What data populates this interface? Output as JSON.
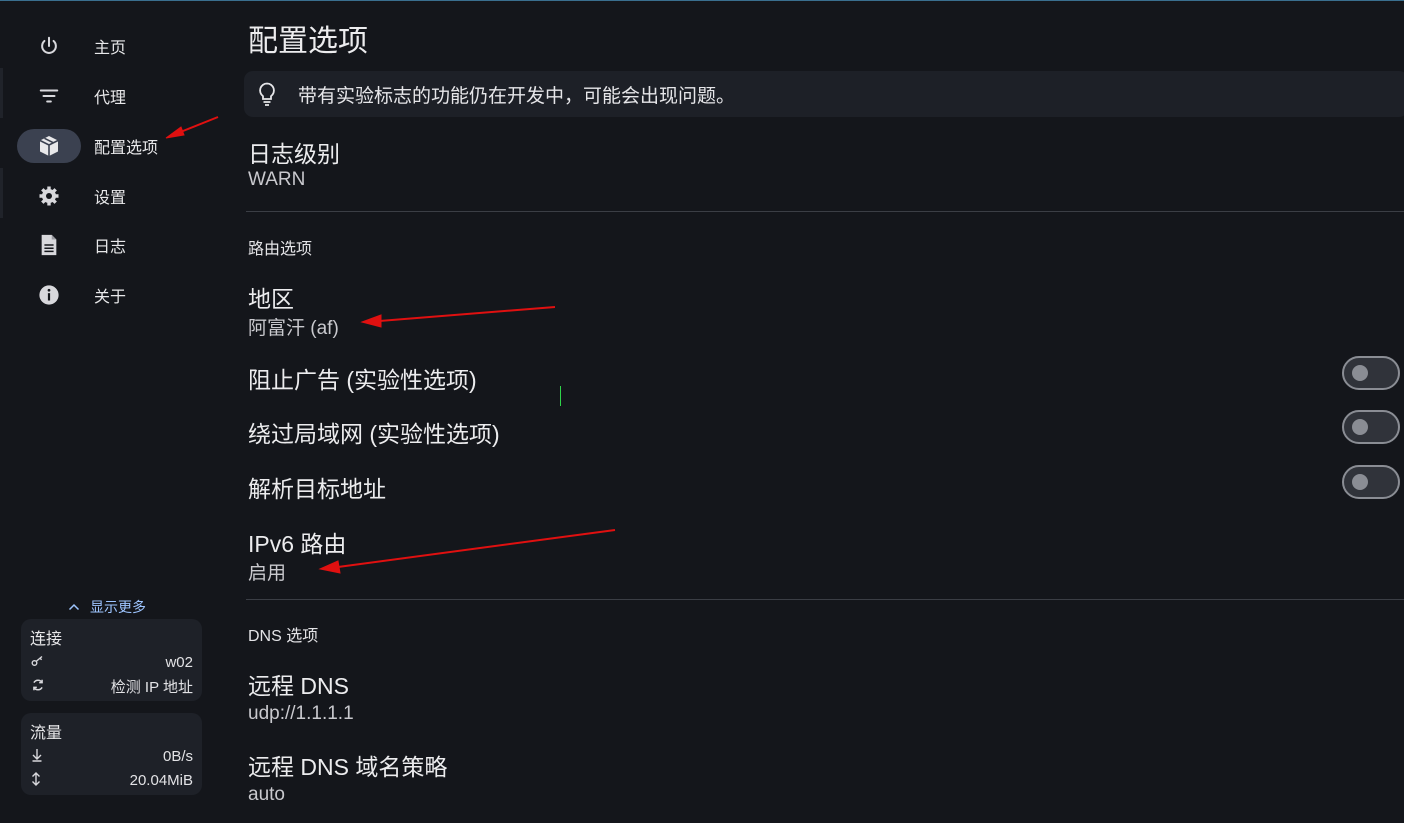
{
  "sidebar": {
    "nav": [
      {
        "label": "主页",
        "icon": "power-icon"
      },
      {
        "label": "代理",
        "icon": "filter-icon"
      },
      {
        "label": "配置选项",
        "icon": "package-icon",
        "active": true
      },
      {
        "label": "设置",
        "icon": "gear-icon"
      },
      {
        "label": "日志",
        "icon": "document-icon"
      },
      {
        "label": "关于",
        "icon": "info-icon"
      }
    ],
    "show_more": "显示更多",
    "connection": {
      "title": "连接",
      "rows": [
        {
          "icon": "key-icon",
          "value": "w02"
        },
        {
          "icon": "refresh-icon",
          "value": "检测 IP 地址"
        }
      ]
    },
    "traffic": {
      "title": "流量",
      "rows": [
        {
          "icon": "arrow-down-icon",
          "value": "0B/s"
        },
        {
          "icon": "arrow-updown-icon",
          "value": "20.04MiB"
        }
      ]
    }
  },
  "main": {
    "title": "配置选项",
    "banner": "带有实验标志的功能仍在开发中，可能会出现问题。",
    "log_level": {
      "title": "日志级别",
      "value": "WARN"
    },
    "routing_section": "路由选项",
    "region": {
      "title": "地区",
      "value": "阿富汗 (af)"
    },
    "block_ads": {
      "title": "阻止广告 (实验性选项)",
      "enabled": false
    },
    "bypass_lan": {
      "title": "绕过局域网 (实验性选项)",
      "enabled": false
    },
    "resolve_dest": {
      "title": "解析目标地址",
      "enabled": false
    },
    "ipv6_route": {
      "title": "IPv6 路由",
      "value": "启用"
    },
    "dns_section": "DNS 选项",
    "remote_dns": {
      "title": "远程 DNS",
      "value": "udp://1.1.1.1"
    },
    "remote_dns_strategy": {
      "title": "远程 DNS 域名策略",
      "value": "auto"
    }
  },
  "colors": {
    "accent": "#9ec5ff",
    "background": "#14161b",
    "annotation_arrow": "#e01010"
  }
}
